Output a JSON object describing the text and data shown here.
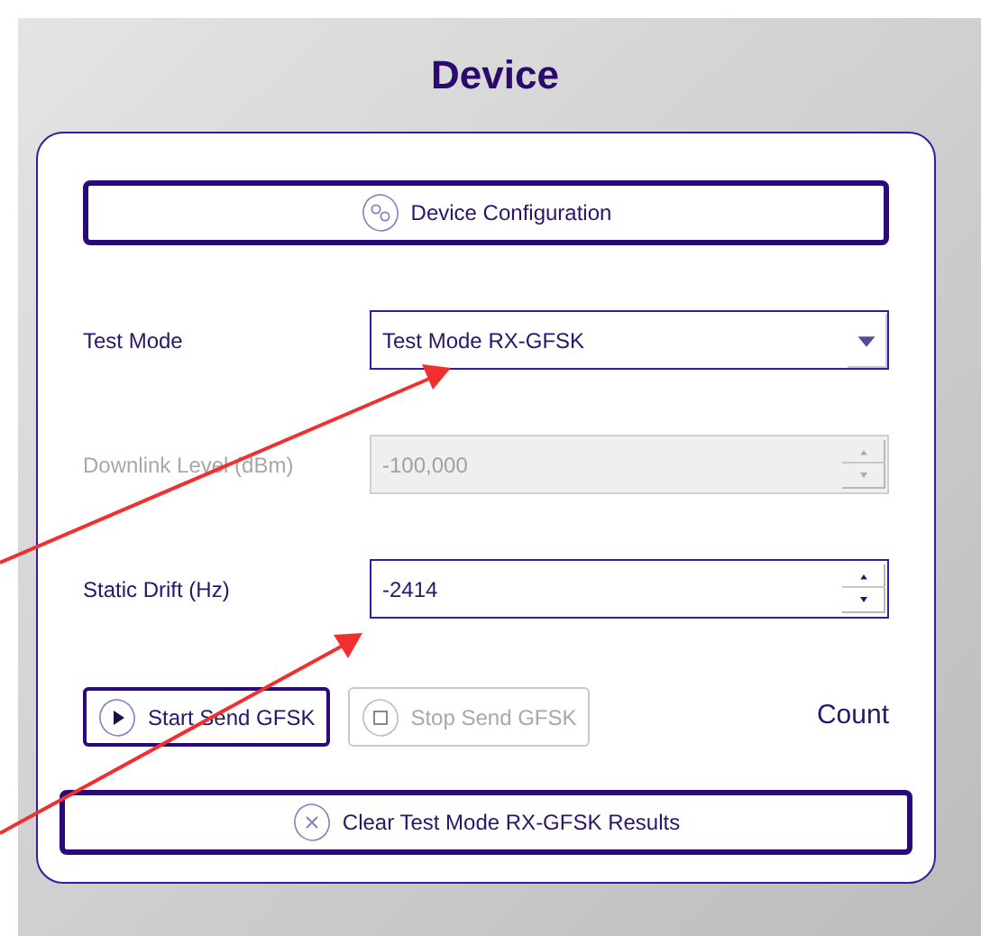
{
  "title": "Device",
  "config_button": {
    "label": "Device Configuration"
  },
  "fields": [
    {
      "kind": "select",
      "label": "Test Mode",
      "value": "Test Mode RX-GFSK",
      "disabled": false
    },
    {
      "kind": "spin",
      "label": "Downlink Level (dBm)",
      "value": "-100,000",
      "disabled": true
    },
    {
      "kind": "spin",
      "label": "Static Drift (Hz)",
      "value": "-2414",
      "disabled": false
    }
  ],
  "send_buttons": [
    {
      "kind": "start",
      "label": "Start Send GFSK",
      "disabled": false
    },
    {
      "kind": "stop",
      "label": "Stop Send GFSK",
      "disabled": true
    }
  ],
  "count_label": "Count",
  "clear_button": {
    "label": "Clear Test Mode RX-GFSK Results"
  }
}
